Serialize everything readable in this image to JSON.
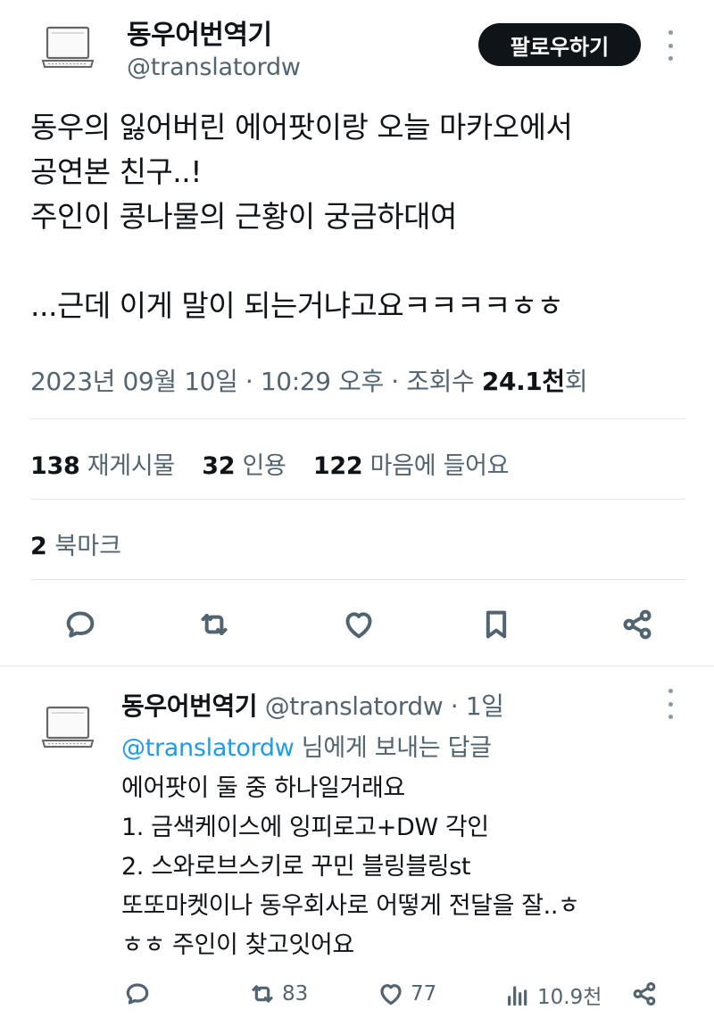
{
  "author": {
    "name": "동우어번역기",
    "handle": "@translatordw",
    "avatar_icon": "laptop-icon"
  },
  "follow_label": "팔로우하기",
  "tweet": {
    "lines": [
      "동우의 잃어버린 에어팟이랑 오늘 마카오에서",
      "공연본 친구..!",
      "주인이 콩나물의 근황이 궁금하대여",
      "",
      "...근데 이게 말이 되는거냐고요ㅋㅋㅋㅋㅎㅎ"
    ],
    "timestamp": "2023년 09월 10일 · 10:29 오후 · 조회수 ",
    "views_count": "24.1천",
    "views_suffix": "회"
  },
  "stats": {
    "reposts_count": "138",
    "reposts_label": "재게시물",
    "quotes_count": "32",
    "quotes_label": "인용",
    "likes_count": "122",
    "likes_label": "마음에 들어요",
    "bookmarks_count": "2",
    "bookmarks_label": "북마크"
  },
  "actions": {
    "icons": [
      "reply-icon",
      "repost-icon",
      "like-icon",
      "bookmark-icon",
      "share-icon"
    ]
  },
  "reply": {
    "name": "동우어번역기",
    "handle": "@translatordw",
    "dot": " · ",
    "time": "1일",
    "reply_to_handle": "@translatordw",
    "reply_to_suffix": " 님에게 보내는 답글",
    "lines": [
      "에어팟이 둘 중 하나일거래요",
      "1. 금색케이스에 잉피로고+DW 각인",
      "2. 스와로브스키로 꾸민 블링블링st",
      "또또마켓이나 동우회사로 어떻게 전달을 잘..ㅎ",
      "ㅎㅎ 주인이 찾고잇어요"
    ],
    "reposts": "83",
    "likes": "77",
    "views": "10.9천"
  },
  "colors": {
    "text": "#0f1419",
    "secondary": "#536471",
    "link": "#1d9bf0",
    "divider": "#e6e9eb",
    "follow_bg": "#0f1419"
  }
}
